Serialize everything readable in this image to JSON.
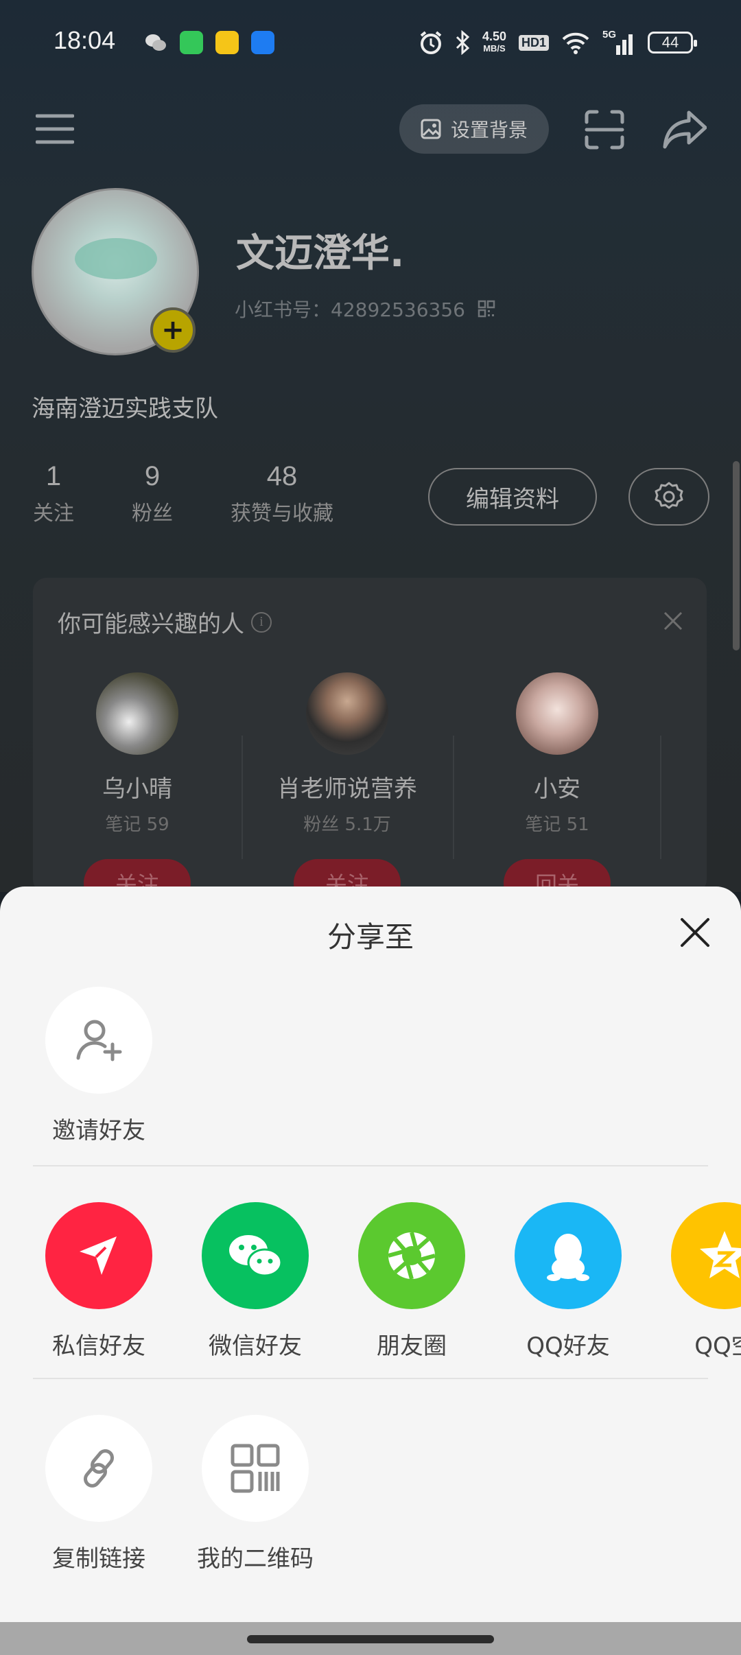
{
  "status_bar": {
    "time": "18:04",
    "net_speed_value": "4.50",
    "net_speed_unit": "MB/S",
    "hd": "HD1",
    "signal": "5G",
    "battery": "44",
    "icons": [
      "wechat-icon",
      "message-app-icon",
      "notes-app-icon",
      "security-app-icon",
      "alarm-icon",
      "bluetooth-icon",
      "wifi-icon",
      "signal-icon"
    ]
  },
  "top_bar": {
    "set_background_label": "设置背景"
  },
  "profile": {
    "nickname": "文迈澄华.",
    "red_id": "小红书号：42892536356",
    "bio": "海南澄迈实践支队",
    "stats": [
      {
        "num": "1",
        "label": "关注"
      },
      {
        "num": "9",
        "label": "粉丝"
      },
      {
        "num": "48",
        "label": "获赞与收藏"
      }
    ],
    "edit_label": "编辑资料"
  },
  "recommend": {
    "title": "你可能感兴趣的人",
    "people": [
      {
        "name": "乌小晴",
        "sub": "笔记 59",
        "button": "关注"
      },
      {
        "name": "肖老师说营养",
        "sub": "粉丝 5.1万",
        "button": "关注"
      },
      {
        "name": "小安",
        "sub": "笔记 51",
        "button": "回关"
      }
    ]
  },
  "share_sheet": {
    "title": "分享至",
    "invite": {
      "label": "邀请好友"
    },
    "row1": [
      {
        "label": "私信好友",
        "color": "#ff2442"
      },
      {
        "label": "微信好友",
        "color": "#07c160"
      },
      {
        "label": "朋友圈",
        "color": "#5bc92f"
      },
      {
        "label": "QQ好友",
        "color": "#1ab7f5"
      },
      {
        "label": "QQ空",
        "color": "#ffc300"
      }
    ],
    "row2": [
      {
        "label": "复制链接"
      },
      {
        "label": "我的二维码"
      }
    ]
  }
}
